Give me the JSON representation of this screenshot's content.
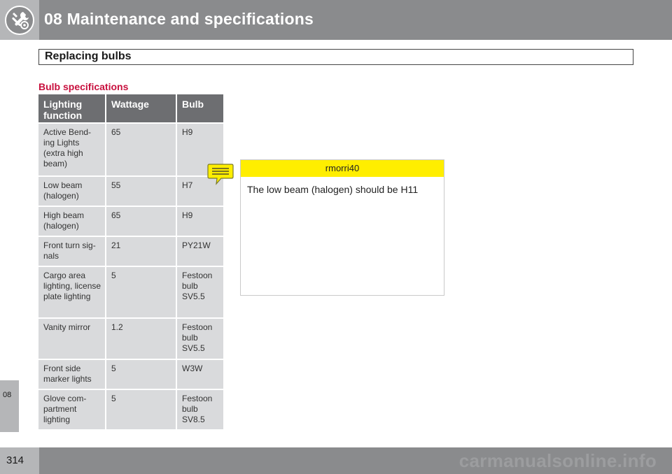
{
  "header": {
    "title": "08 Maintenance and specifications",
    "icon": "wrench-gear-icon"
  },
  "section": {
    "title": "Replacing bulbs"
  },
  "chapter_tab": {
    "label": "08"
  },
  "table": {
    "heading": "Bulb specifications",
    "columns": [
      "Lighting function",
      "Wattage",
      "Bulb"
    ],
    "rows": [
      [
        "Active Bend-ing Lights (extra high beam)",
        "65",
        "H9"
      ],
      [
        "Low beam (halogen)",
        "55",
        "H7"
      ],
      [
        "High beam (halogen)",
        "65",
        "H9"
      ],
      [
        "Front turn sig-nals",
        "21",
        "PY21W"
      ],
      [
        "Cargo area lighting, license plate lighting",
        "5",
        "Festoon bulb SV5.5"
      ],
      [
        "Vanity mirror",
        "1.2",
        "Festoon bulb SV5.5"
      ],
      [
        "Front side marker lights",
        "5",
        "W3W"
      ],
      [
        "Glove com-partment lighting",
        "5",
        "Festoon bulb SV8.5"
      ]
    ]
  },
  "comment": {
    "icon": "comment-note-icon",
    "author": "rmorri40",
    "text": "The low beam (halogen) should be H11",
    "accent_color": "#ffee00"
  },
  "footer": {
    "page_number": "314",
    "watermark": "carmanualsonline.info"
  },
  "colors": {
    "header_bg": "#8a8b8d",
    "table_header_bg": "#6d6e71",
    "table_row_bg": "#d9dadc",
    "heading_color": "#c8103e"
  }
}
